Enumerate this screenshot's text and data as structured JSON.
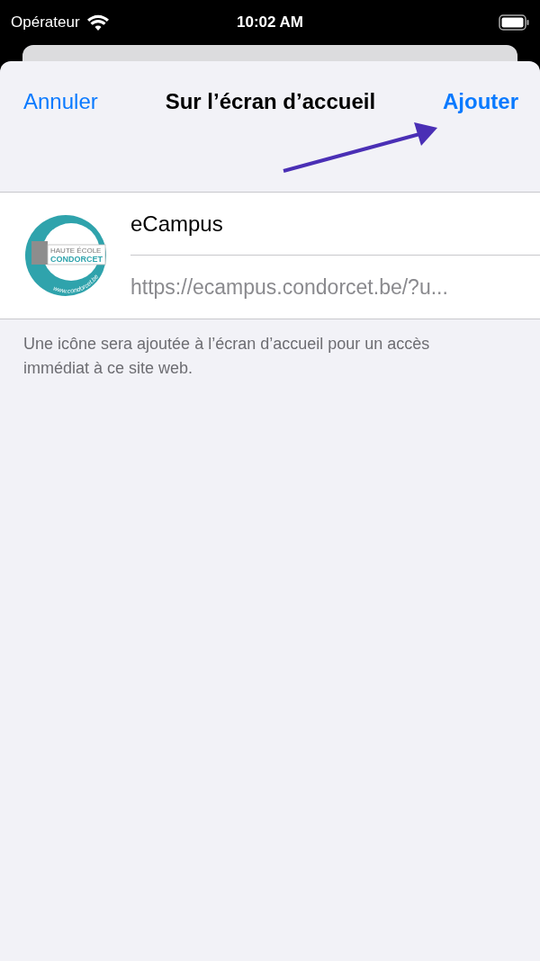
{
  "status_bar": {
    "carrier": "Opérateur",
    "time": "10:02 AM"
  },
  "nav": {
    "cancel": "Annuler",
    "title": "Sur l’écran d’accueil",
    "add": "Ajouter"
  },
  "bookmark": {
    "logo": {
      "line_1": "HAUTE ÉCOLE",
      "line_2": "CONDORCET",
      "url": "www.condorcet.be"
    },
    "name": "eCampus",
    "url": "https://ecampus.condorcet.be/?u..."
  },
  "footer": "Une icône sera ajoutée à l’écran d’accueil pour un accès immédiat à ce site web."
}
